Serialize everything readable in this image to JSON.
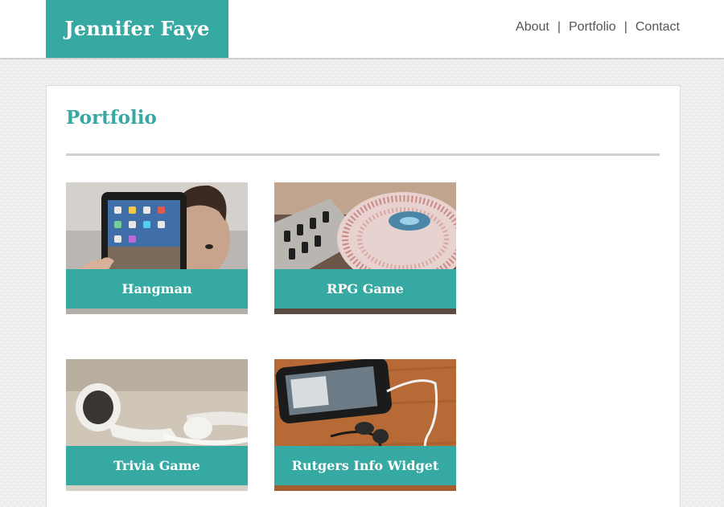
{
  "header": {
    "brand": "Jennifer Faye",
    "nav": [
      {
        "label": "About"
      },
      {
        "label": "Portfolio"
      },
      {
        "label": "Contact"
      }
    ],
    "separator": "|"
  },
  "main": {
    "title": "Portfolio",
    "projects": [
      {
        "title": "Hangman",
        "image_icon": "tablet-photo"
      },
      {
        "title": "RPG Game",
        "image_icon": "turntable-photo"
      },
      {
        "title": "Trivia Game",
        "image_icon": "earbuds-photo"
      },
      {
        "title": "Rutgers Info Widget",
        "image_icon": "smartphone-photo"
      }
    ]
  },
  "colors": {
    "accent": "#37a9a3",
    "nav_text": "#555555",
    "background": "#ececec"
  }
}
